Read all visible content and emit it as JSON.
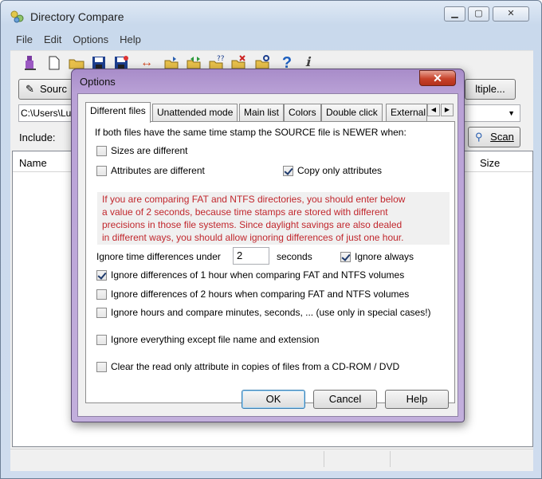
{
  "main_window": {
    "title": "Directory Compare",
    "menu": [
      "File",
      "Edit",
      "Options",
      "Help"
    ],
    "source_button": "Sourc",
    "multiple_button": "ltiple...",
    "path": "C:\\Users\\Lu",
    "include_label": "Include:",
    "scan_button": "Scan",
    "columns": {
      "name": "Name",
      "size": "Size"
    },
    "toolbar_icons": [
      "person-icon",
      "new-document-icon",
      "open-folder-icon",
      "save-icon",
      "save-as-icon",
      "swap-arrows-icon",
      "folder-compare-icon",
      "folder-sync-icon",
      "folder-question-icon",
      "folder-delete-icon",
      "folder-search-icon",
      "help-icon",
      "about-icon"
    ]
  },
  "dialog": {
    "title": "Options",
    "close_glyph": "✕",
    "tabs": [
      "Different files",
      "Unattended mode",
      "Main list",
      "Colors",
      "Double click",
      "External"
    ],
    "active_tab": "Different files",
    "intro": "If both files have the same time stamp the SOURCE file is NEWER when:",
    "options": {
      "sizes_different": {
        "label": "Sizes are different",
        "checked": false
      },
      "attributes_different": {
        "label": "Attributes are different",
        "checked": false
      },
      "copy_only_attributes": {
        "label": "Copy only attributes",
        "checked": true
      },
      "ignore_1_hour": {
        "label": "Ignore differences of 1 hour when comparing FAT and NTFS volumes",
        "checked": true
      },
      "ignore_2_hours": {
        "label": "Ignore differences of 2 hours when comparing FAT and NTFS volumes",
        "checked": false
      },
      "ignore_hours_minutes": {
        "label": "Ignore hours and compare minutes, seconds, ... (use only in special cases!)",
        "checked": false
      },
      "ignore_everything": {
        "label": "Ignore everything except file name and extension",
        "checked": false
      },
      "clear_readonly": {
        "label": "Clear the read only attribute in copies of files from a CD-ROM / DVD",
        "checked": false
      },
      "ignore_always": {
        "label": "Ignore always",
        "checked": true
      }
    },
    "warning_lines": [
      "If you are comparing FAT and NTFS directories, you should enter below",
      "a value of 2 seconds,  because time stamps are  stored with different",
      "precisions in those file systems. Since daylight savings are also dealed",
      "in different ways, you should allow ignoring differences of just one hour."
    ],
    "time_diff_label": "Ignore time differences under",
    "time_diff_value": "2",
    "seconds_label": "seconds",
    "buttons": {
      "ok": "OK",
      "cancel": "Cancel",
      "help": "Help"
    }
  },
  "colors": {
    "warning_text": "#c1272d",
    "dialog_frame": "#b9a1d6"
  }
}
